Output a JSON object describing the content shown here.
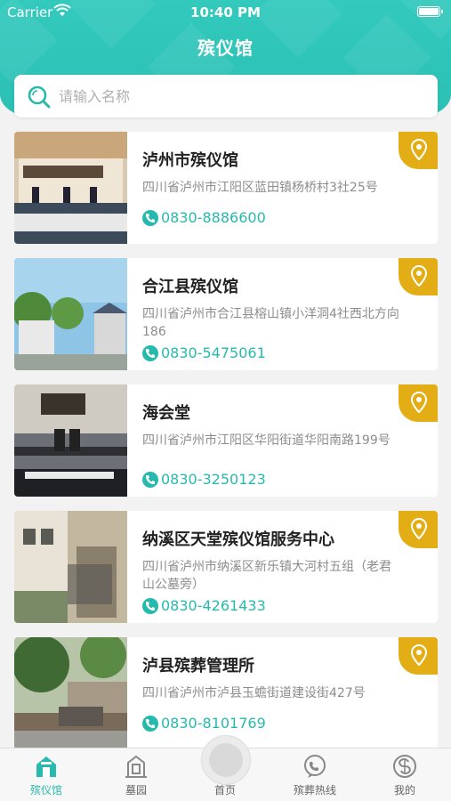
{
  "status_bar": {
    "carrier": "Carrier",
    "time": "10:40 PM"
  },
  "header": {
    "title": "殡仪馆"
  },
  "search": {
    "placeholder": "请输入名称"
  },
  "homes": [
    {
      "name": "泸州市殡仪馆",
      "address": "四川省泸州市江阳区蓝田镇杨桥村3社25号",
      "phone": "0830-8886600"
    },
    {
      "name": "合江县殡仪馆",
      "address": "四川省泸州市合江县榕山镇小洋洞4社西北方向186",
      "phone": "0830-5475061"
    },
    {
      "name": "海会堂",
      "address": "四川省泸州市江阳区华阳街道华阳南路199号",
      "phone": "0830-3250123"
    },
    {
      "name": "纳溪区天堂殡仪馆服务中心",
      "address": "四川省泸州市纳溪区新乐镇大河村五组（老君山公墓旁）",
      "phone": "0830-4261433"
    },
    {
      "name": "泸县殡葬管理所",
      "address": "四川省泸州市泸县玉蟾街道建设街427号",
      "phone": "0830-8101769"
    }
  ],
  "tabs": [
    {
      "label": "殡仪馆",
      "icon": "funeral-home-icon",
      "active": true
    },
    {
      "label": "墓园",
      "icon": "cemetery-icon",
      "active": false
    },
    {
      "label": "首页",
      "icon": "home-icon",
      "active": false
    },
    {
      "label": "殡葬热线",
      "icon": "hotline-icon",
      "active": false
    },
    {
      "label": "我的",
      "icon": "profile-icon",
      "active": false
    }
  ],
  "colors": {
    "primary": "#2cc0b4",
    "accent": "#e3ad16",
    "phone": "#27b9ad"
  }
}
